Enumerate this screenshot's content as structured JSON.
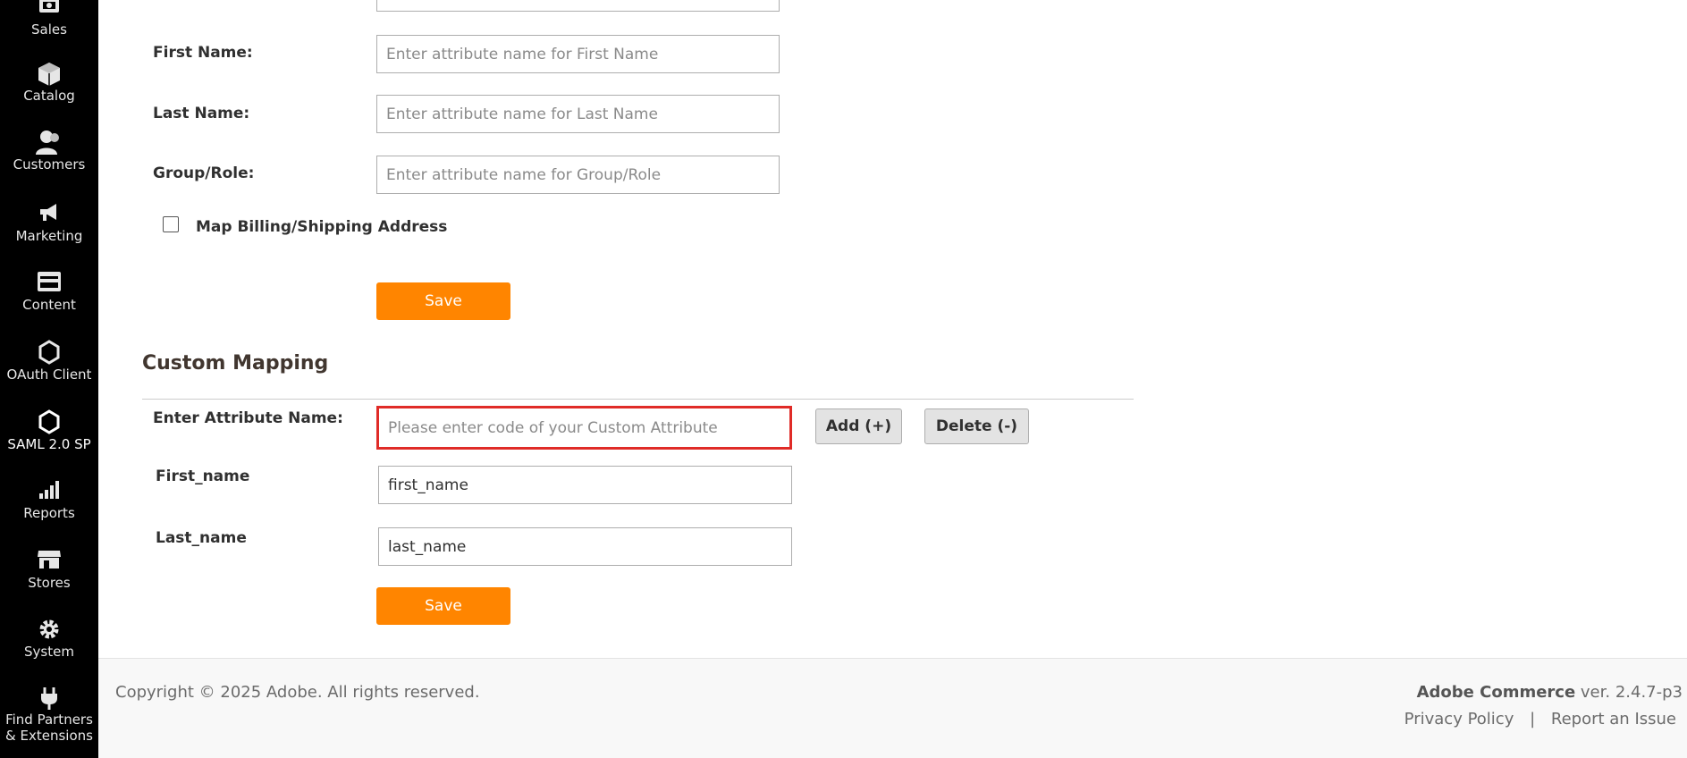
{
  "sidebar": {
    "items": [
      {
        "label": "Sales",
        "icon": "sales-icon"
      },
      {
        "label": "Catalog",
        "icon": "catalog-icon"
      },
      {
        "label": "Customers",
        "icon": "customers-icon"
      },
      {
        "label": "Marketing",
        "icon": "marketing-icon"
      },
      {
        "label": "Content",
        "icon": "content-icon"
      },
      {
        "label": "OAuth Client",
        "icon": "hexagon-icon"
      },
      {
        "label": "SAML 2.0 SP",
        "icon": "hexagon-icon"
      },
      {
        "label": "Reports",
        "icon": "reports-icon"
      },
      {
        "label": "Stores",
        "icon": "stores-icon"
      },
      {
        "label": "System",
        "icon": "gear-icon"
      },
      {
        "label": "Find Partners & Extensions",
        "icon": "plug-icon"
      }
    ]
  },
  "attribute_mapping": {
    "first_name": {
      "label": "First Name:",
      "placeholder": "Enter attribute name for First Name"
    },
    "last_name": {
      "label": "Last Name:",
      "placeholder": "Enter attribute name for Last Name"
    },
    "group_role": {
      "label": "Group/Role:",
      "placeholder": "Enter attribute name for Group/Role"
    },
    "map_address_label": "Map Billing/Shipping Address",
    "save_label": "Save"
  },
  "custom_mapping": {
    "title": "Custom Mapping",
    "attr_label": "Enter Attribute Name:",
    "attr_placeholder": "Please enter code of your Custom Attribute",
    "add_label": "Add (+)",
    "delete_label": "Delete (-)",
    "rows": [
      {
        "label": "First_name",
        "value": "first_name"
      },
      {
        "label": "Last_name",
        "value": "last_name"
      }
    ],
    "save_label": "Save"
  },
  "footer": {
    "copyright": "Copyright © 2025 Adobe. All rights reserved.",
    "product": "Adobe Commerce",
    "version": "ver. 2.4.7-p3",
    "privacy": "Privacy Policy",
    "separator": "|",
    "report": "Report an Issue"
  },
  "colors": {
    "sidebar_bg": "#000000",
    "accent": "#ff8500",
    "highlight_border": "#e02b27"
  }
}
